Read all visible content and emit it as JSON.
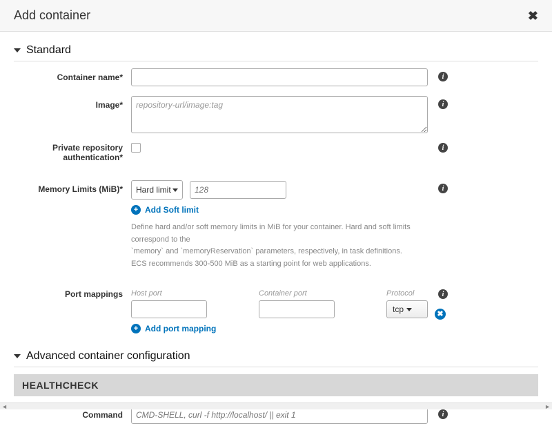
{
  "header": {
    "title": "Add container"
  },
  "sections": {
    "standard": {
      "label": "Standard"
    },
    "advanced": {
      "label": "Advanced container configuration",
      "healthcheck_heading": "HEALTHCHECK"
    }
  },
  "fields": {
    "container_name": {
      "label": "Container name*",
      "value": ""
    },
    "image": {
      "label": "Image*",
      "placeholder": "repository-url/image:tag",
      "value": ""
    },
    "private_repo": {
      "label": "Private repository authentication*"
    },
    "memory": {
      "label": "Memory Limits (MiB)*",
      "limit_type": "Hard limit",
      "placeholder": "128",
      "add_soft_label": "Add Soft limit",
      "help_line1": "Define hard and/or soft memory limits in MiB for your container. Hard and soft limits correspond to the",
      "help_line2": "`memory` and `memoryReservation` parameters, respectively, in task definitions.",
      "help_line3": "ECS recommends 300-500 MiB as a starting point for web applications."
    },
    "port_mappings": {
      "label": "Port mappings",
      "host_label": "Host port",
      "container_label": "Container port",
      "protocol_label": "Protocol",
      "protocol_value": "tcp",
      "add_label": "Add port mapping"
    },
    "command": {
      "label": "Command",
      "placeholder": "CMD-SHELL, curl -f http://localhost/ || exit 1",
      "value": ""
    }
  }
}
